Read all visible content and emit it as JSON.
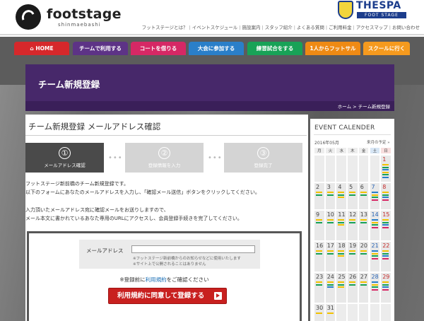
{
  "brand": {
    "name": "footstage",
    "sub": "shinmaebashi"
  },
  "partner": {
    "name": "THESPA",
    "sub": "FOOT STAGE"
  },
  "top_nav": [
    "フットステージとは？",
    "イベントスケジュール",
    "施設案内",
    "スタッフ紹介",
    "よくある質問",
    "ご利用料金",
    "アクセスマップ",
    "お問い合わせ"
  ],
  "main_nav": [
    {
      "label": "HOME",
      "color": "#d6282b",
      "icon": "home-icon"
    },
    {
      "label": "チームで利用する",
      "color": "#5d3386"
    },
    {
      "label": "コートを借りる",
      "color": "#d62865"
    },
    {
      "label": "大会に参加する",
      "color": "#2a7fc9"
    },
    {
      "label": "練習試合をする",
      "color": "#18a257"
    },
    {
      "label": "1人からフットサル",
      "color": "#ef8a14"
    },
    {
      "label": "スクールに行く",
      "color": "#f59a1e"
    }
  ],
  "hero": {
    "title": "チーム新規登録"
  },
  "breadcrumb": {
    "home": "ホーム",
    "current": "チーム新規登録"
  },
  "page": {
    "heading": "チーム新規登録 メールアドレス確認",
    "steps": [
      {
        "num": "①",
        "label": "メールアドレス確認"
      },
      {
        "num": "②",
        "label": "登録情報を入力"
      },
      {
        "num": "③",
        "label": "登録完了"
      }
    ],
    "text1": "フットステージ新前橋のチーム新規登録です。",
    "text2": "以下のフォームにあなたのメールアドレスを入力し、「確認メール送信」ボタンをクリックしてください。",
    "text3": "入力頂いたメールアドレス宛に確認メールをお送りしますので、",
    "text4": "メール本文に書かれているあなた専用のURLにアクセスし、会員登録手続きを完了してください。"
  },
  "form": {
    "email_label": "メールアドレス",
    "email_value": "",
    "note1": "※フットステージ新前橋からのお知らせなどに使用いたします",
    "note2": "※サイト上で公開されることはありません",
    "consent_before": "※登録前に",
    "consent_link": "利用規約",
    "consent_after": "をご確認ください",
    "submit_label": "利用規約に同意して登録する"
  },
  "calendar": {
    "title": "EVENT CALENDER",
    "year_month": "2016年05月",
    "next_label": "来月の予定 »",
    "weekdays": [
      "月",
      "火",
      "水",
      "木",
      "金",
      "土",
      "日"
    ],
    "weeks": [
      [
        {
          "d": ""
        },
        {
          "d": ""
        },
        {
          "d": ""
        },
        {
          "d": ""
        },
        {
          "d": ""
        },
        {
          "d": ""
        },
        {
          "d": "1",
          "ev": [
            "#f2c200",
            "#18a257",
            "#2a7fc9",
            "#f2c200",
            "#18a257",
            "#2a7fc9"
          ]
        }
      ],
      [
        {
          "d": "2",
          "ev": [
            "#f2c200",
            "#18a257"
          ]
        },
        {
          "d": "3",
          "ev": [
            "#f2c200",
            "#18a257"
          ]
        },
        {
          "d": "4",
          "ev": [
            "#f2c200",
            "#18a257",
            "#f2c200"
          ]
        },
        {
          "d": "5",
          "ev": [
            "#f2c200",
            "#18a257"
          ]
        },
        {
          "d": "6",
          "ev": [
            "#f2c200",
            "#18a257"
          ]
        },
        {
          "d": "7",
          "ev": [
            "#2a7fc9",
            "#f2c200",
            "#18a257",
            "#d62865"
          ]
        },
        {
          "d": "8",
          "ev": [
            "#f2c200",
            "#18a257",
            "#2a7fc9",
            "#d62865"
          ]
        }
      ],
      [
        {
          "d": "9",
          "ev": [
            "#f2c200",
            "#18a257"
          ]
        },
        {
          "d": "10",
          "ev": [
            "#f2c200",
            "#18a257"
          ]
        },
        {
          "d": "11",
          "ev": [
            "#f2c200",
            "#18a257",
            "#f2c200"
          ]
        },
        {
          "d": "12",
          "ev": [
            "#f2c200",
            "#18a257"
          ]
        },
        {
          "d": "13",
          "ev": [
            "#f2c200",
            "#18a257"
          ]
        },
        {
          "d": "14",
          "ev": [
            "#2a7fc9",
            "#f2c200",
            "#18a257",
            "#d62865"
          ]
        },
        {
          "d": "15",
          "ev": [
            "#f2c200",
            "#18a257",
            "#2a7fc9",
            "#d62865"
          ]
        }
      ],
      [
        {
          "d": "16",
          "ev": [
            "#f2c200",
            "#18a257"
          ]
        },
        {
          "d": "17",
          "ev": [
            "#f2c200",
            "#18a257"
          ]
        },
        {
          "d": "18",
          "ev": [
            "#f2c200",
            "#18a257",
            "#f2c200"
          ]
        },
        {
          "d": "19",
          "ev": [
            "#f2c200",
            "#18a257"
          ]
        },
        {
          "d": "20",
          "ev": [
            "#f2c200",
            "#18a257"
          ]
        },
        {
          "d": "21",
          "ev": [
            "#2a7fc9",
            "#f2c200",
            "#18a257",
            "#d62865"
          ]
        },
        {
          "d": "22",
          "ev": [
            "#f2c200",
            "#18a257",
            "#2a7fc9",
            "#d62865"
          ]
        }
      ],
      [
        {
          "d": "23",
          "ev": [
            "#f2c200",
            "#18a257"
          ]
        },
        {
          "d": "24",
          "ev": [
            "#f2c200",
            "#18a257",
            "#2a7fc9"
          ]
        },
        {
          "d": "25",
          "ev": [
            "#f2c200",
            "#18a257",
            "#f2c200"
          ]
        },
        {
          "d": "26",
          "ev": [
            "#f2c200",
            "#18a257"
          ]
        },
        {
          "d": "27",
          "ev": [
            "#f2c200",
            "#18a257"
          ]
        },
        {
          "d": "28",
          "ev": [
            "#2a7fc9",
            "#f2c200",
            "#18a257",
            "#d62865"
          ]
        },
        {
          "d": "29",
          "ev": [
            "#f2c200",
            "#18a257",
            "#2a7fc9",
            "#d62865"
          ]
        }
      ],
      [
        {
          "d": "30",
          "ev": [
            "#f2c200"
          ]
        },
        {
          "d": "31",
          "ev": [
            "#f2c200"
          ]
        }
      ]
    ]
  }
}
